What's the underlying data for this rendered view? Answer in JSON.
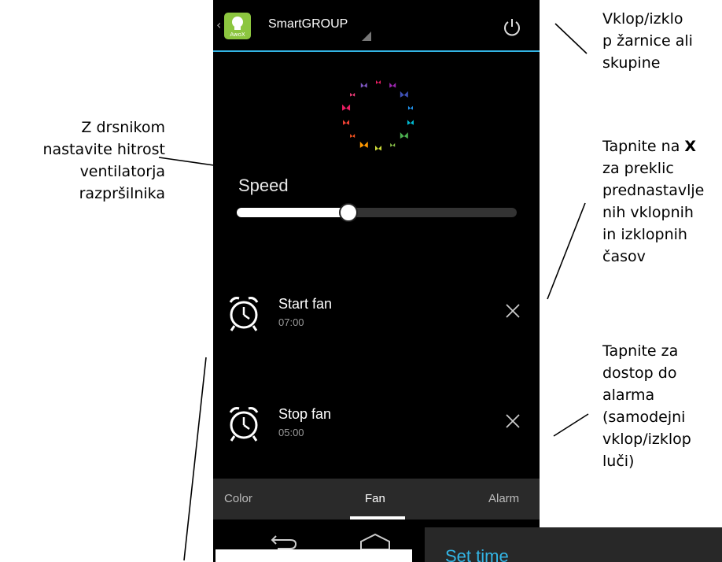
{
  "annotations": {
    "power_note": [
      "Vklop/izklo",
      "p žarnice ali",
      "skupine"
    ],
    "slider_note": [
      "Z drsnikom",
      "nastavite hitrost",
      "ventilatorja",
      "razpršilnika"
    ],
    "cancel_note": {
      "prefix": "Tapnite na ",
      "bold": "X",
      "lines": [
        "za preklic",
        "prednastavlje",
        "nih vklopnih",
        "in izklopnih",
        "časov"
      ]
    },
    "alarm_note": [
      "Tapnite za",
      "dostop do",
      "alarma",
      "(samodejni",
      "vklop/izklop",
      "luči)"
    ]
  },
  "app": {
    "title": "SmartGROUP",
    "icon_brand": "AwoX",
    "icons": {
      "back": "chevron-left-icon",
      "logo": "bulb-logo-icon",
      "power": "power-icon"
    }
  },
  "speed": {
    "label": "Speed",
    "value": 0.4
  },
  "alarms": [
    {
      "name": "Start fan",
      "time": "07:00"
    },
    {
      "name": "Stop fan",
      "time": "05:00"
    }
  ],
  "tabs": [
    {
      "label": "Color",
      "active": false
    },
    {
      "label": "Fan",
      "active": true
    },
    {
      "label": "Alarm",
      "active": false
    }
  ],
  "navbar": {
    "icons": [
      "back-nav-icon",
      "home-nav-icon"
    ]
  },
  "dialog": {
    "title": "Set time"
  },
  "colors": {
    "accent": "#33b5e5",
    "brand_green": "#8cc63f"
  }
}
